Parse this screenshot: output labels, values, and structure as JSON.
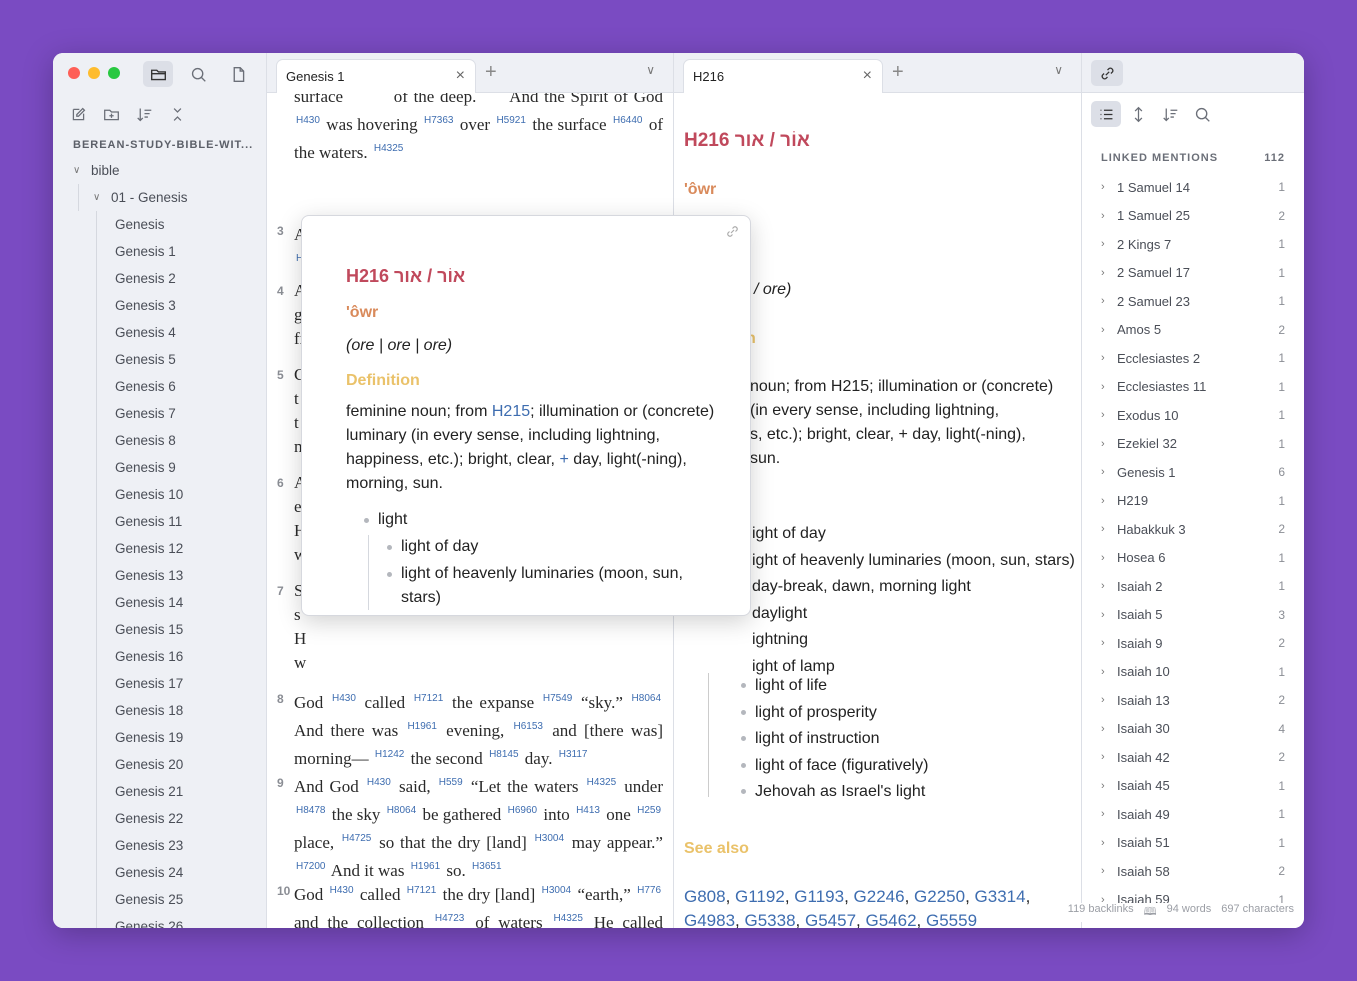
{
  "sidebar": {
    "vault_name": "BEREAN-STUDY-BIBLE-WIT...",
    "folder": "bible",
    "subfolder": "01 - Genesis",
    "files": [
      "Genesis",
      "Genesis 1",
      "Genesis 2",
      "Genesis 3",
      "Genesis 4",
      "Genesis 5",
      "Genesis 6",
      "Genesis 7",
      "Genesis 8",
      "Genesis 9",
      "Genesis 10",
      "Genesis 11",
      "Genesis 12",
      "Genesis 13",
      "Genesis 14",
      "Genesis 15",
      "Genesis 16",
      "Genesis 17",
      "Genesis 18",
      "Genesis 19",
      "Genesis 20",
      "Genesis 21",
      "Genesis 22",
      "Genesis 23",
      "Genesis 24",
      "Genesis 25",
      "Genesis 26"
    ]
  },
  "pane1": {
    "tab_label": "Genesis 1"
  },
  "pane2": {
    "tab_label": "H216",
    "title": "H216 אוֹר / אור",
    "translit": "'ôwr",
    "pron_partial": "/ ore)",
    "definition_partial_heading": "n",
    "def_lines": [
      "noun; from H215; illumination or (concrete)",
      "(in every sense, including lightning,",
      "s, etc.); bright, clear, + day, light(-ning),",
      "sun."
    ],
    "senses": [
      "ight of day",
      "ight of heavenly luminaries (moon, sun, stars)",
      "day-break, dawn, morning light",
      "daylight",
      "ightning",
      "ight of lamp"
    ],
    "senses_full": [
      "light of life",
      "light of prosperity",
      "light of instruction",
      "light of face (figuratively)",
      "Jehovah as Israel's light"
    ],
    "see_also_heading": "See also",
    "see_also": [
      "G808",
      "G1192",
      "G1193",
      "G2246",
      "G2250",
      "G3314",
      "G4983",
      "G5338",
      "G5457",
      "G5462",
      "G5559"
    ]
  },
  "popover": {
    "title": "H216 אוֹר / אור",
    "translit": "'ôwr",
    "pronunciation": "(ore | ore | ore)",
    "definition_heading": "Definition",
    "definition_pre": "feminine noun; from ",
    "definition_link": "H215",
    "definition_mid": "; illumination or (concrete) luminary (in every sense, including lightning, happiness, etc.); bright, clear, ",
    "definition_plus": "+",
    "definition_post": " day, light(-ning), morning, sun.",
    "bullet_top": "light",
    "bullet_sub": [
      "light of day",
      "light of heavenly luminaries (moon, sun, stars)"
    ]
  },
  "mentions": {
    "heading": "LINKED MENTIONS",
    "total": "112",
    "items": [
      {
        "label": "1 Samuel 14",
        "count": "1"
      },
      {
        "label": "1 Samuel 25",
        "count": "2"
      },
      {
        "label": "2 Kings 7",
        "count": "1"
      },
      {
        "label": "2 Samuel 17",
        "count": "1"
      },
      {
        "label": "2 Samuel 23",
        "count": "1"
      },
      {
        "label": "Amos 5",
        "count": "2"
      },
      {
        "label": "Ecclesiastes 2",
        "count": "1"
      },
      {
        "label": "Ecclesiastes 11",
        "count": "1"
      },
      {
        "label": "Exodus 10",
        "count": "1"
      },
      {
        "label": "Ezekiel 32",
        "count": "1"
      },
      {
        "label": "Genesis 1",
        "count": "6"
      },
      {
        "label": "H219",
        "count": "1"
      },
      {
        "label": "Habakkuk 3",
        "count": "2"
      },
      {
        "label": "Hosea 6",
        "count": "1"
      },
      {
        "label": "Isaiah 2",
        "count": "1"
      },
      {
        "label": "Isaiah 5",
        "count": "3"
      },
      {
        "label": "Isaiah 9",
        "count": "2"
      },
      {
        "label": "Isaiah 10",
        "count": "1"
      },
      {
        "label": "Isaiah 13",
        "count": "2"
      },
      {
        "label": "Isaiah 30",
        "count": "4"
      },
      {
        "label": "Isaiah 42",
        "count": "2"
      },
      {
        "label": "Isaiah 45",
        "count": "1"
      },
      {
        "label": "Isaiah 49",
        "count": "1"
      },
      {
        "label": "Isaiah 51",
        "count": "1"
      },
      {
        "label": "Isaiah 58",
        "count": "2"
      },
      {
        "label": "Isaiah 59",
        "count": "1"
      }
    ]
  },
  "status": {
    "backlinks": "119 backlinks",
    "words": "94 words",
    "chars": "697 characters"
  }
}
